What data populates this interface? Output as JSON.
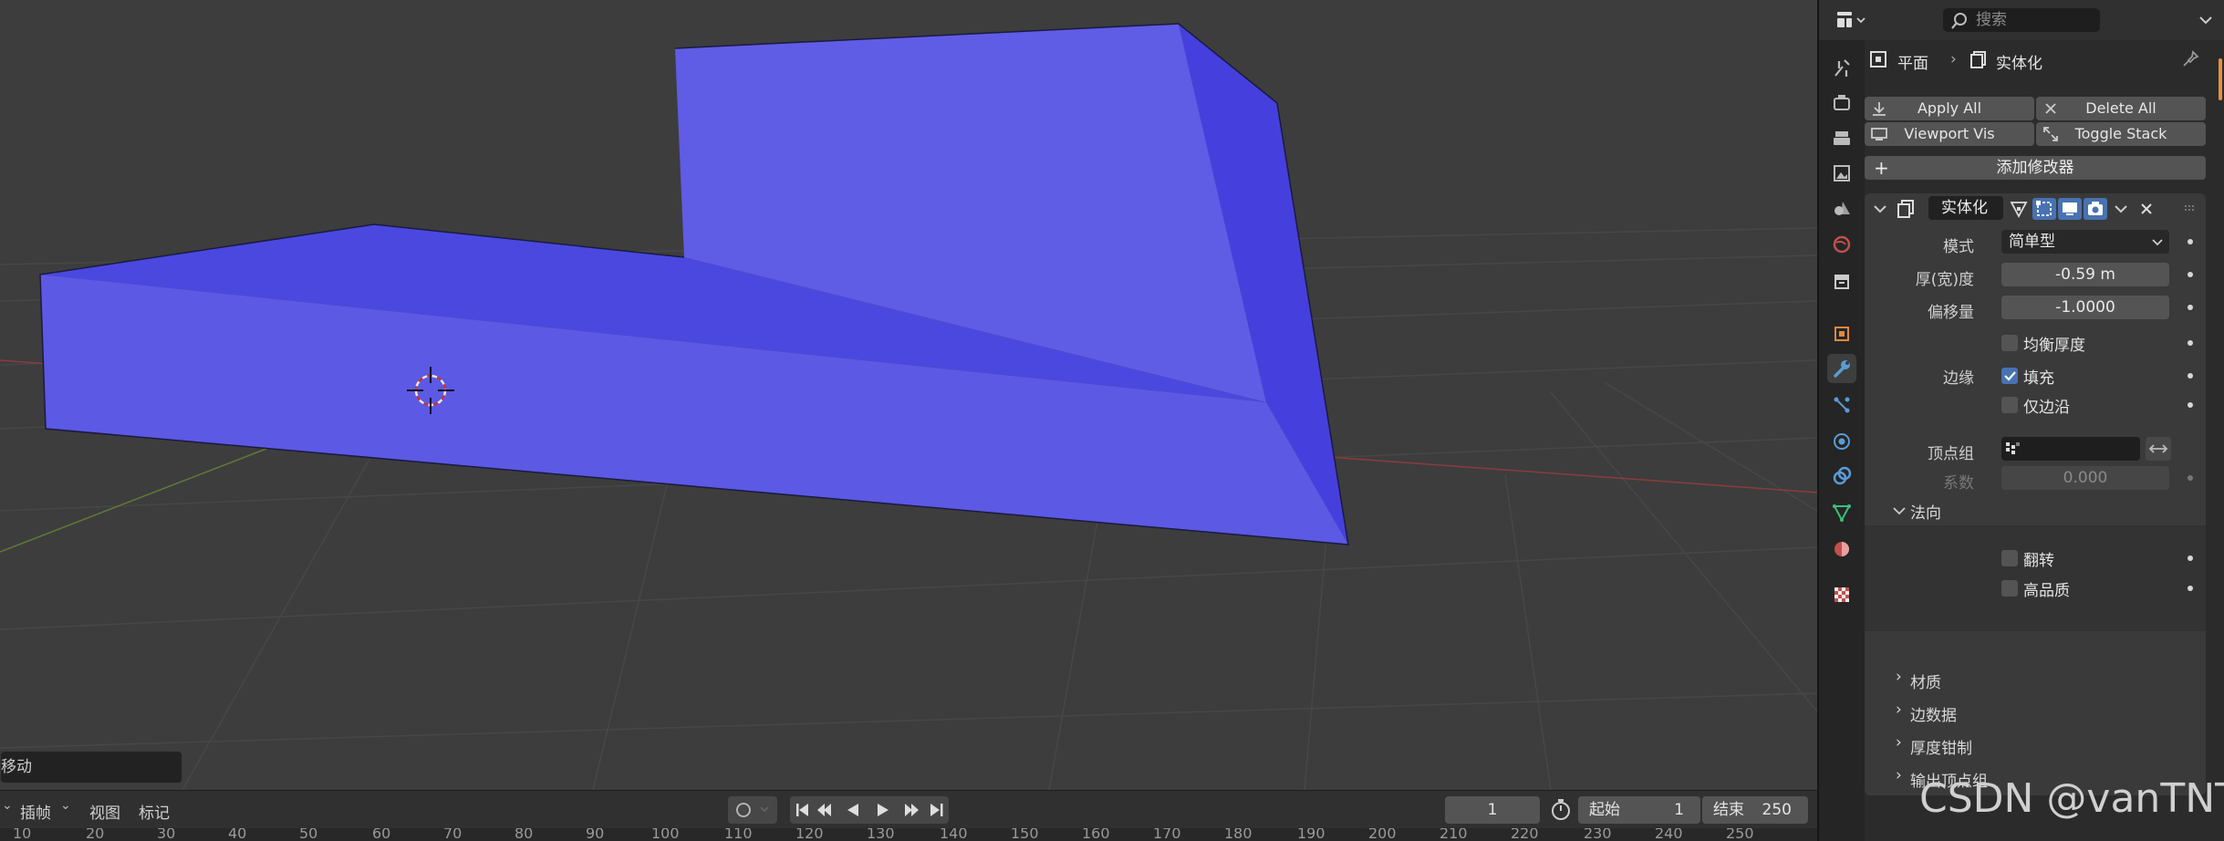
{
  "viewport": {
    "operator_panel_label": "移动"
  },
  "timeline": {
    "menus": [
      "插帧",
      "视图",
      "标记"
    ],
    "current_frame": "1",
    "start_label": "起始",
    "start_value": "1",
    "end_label": "结束",
    "end_value": "250",
    "ruler": [
      "10",
      "20",
      "30",
      "40",
      "50",
      "60",
      "70",
      "80",
      "90",
      "100",
      "110",
      "120",
      "130",
      "140",
      "150",
      "160",
      "170",
      "180",
      "190",
      "200",
      "210",
      "220",
      "230",
      "240",
      "250"
    ]
  },
  "properties": {
    "search_placeholder": "搜索",
    "breadcrumb": {
      "object": "平面",
      "modifier": "实体化"
    },
    "actions": {
      "apply_all": "Apply All",
      "delete_all": "Delete All",
      "viewport_vis": "Viewport Vis",
      "toggle_stack": "Toggle Stack"
    },
    "add_modifier": "添加修改器",
    "modifier": {
      "name": "实体化",
      "mode_label": "模式",
      "mode_value": "简单型",
      "thickness_label": "厚(宽)度",
      "thickness_value": "-0.59 m",
      "offset_label": "偏移量",
      "offset_value": "-1.0000",
      "even_thickness": "均衡厚度",
      "rim_label": "边缘",
      "fill": "填充",
      "only_rim": "仅边沿",
      "vertex_group_label": "顶点组",
      "factor_label": "系数",
      "factor_value": "0.000",
      "normals_panel": "法向",
      "flip": "翻转",
      "high_quality": "高品质",
      "subpanels": [
        "材质",
        "边数据",
        "厚度钳制",
        "输出顶点组"
      ]
    }
  },
  "colors": {
    "mesh_light": "#5f5ce6",
    "mesh_dark": "#4540dd",
    "accent": "#4772b3",
    "viewport_bg": "#3d3d3d"
  },
  "watermark": "CSDN @vanTNT"
}
